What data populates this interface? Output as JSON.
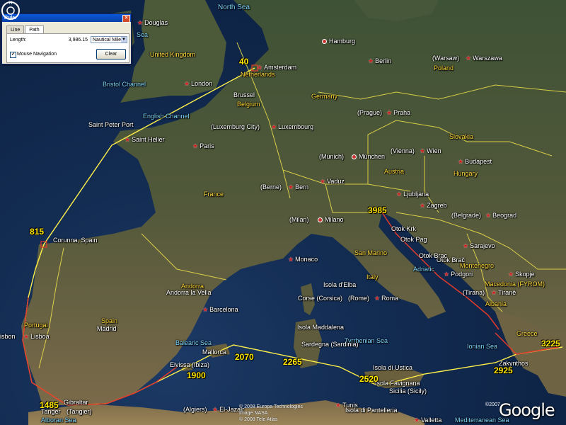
{
  "ruler": {
    "title": "Ruler",
    "close": "×",
    "tabs": [
      "Line",
      "Path"
    ],
    "active_tab": "Path",
    "length_label": "Length:",
    "length_value": "3,986.15",
    "units": "Nautical Miles",
    "mouse_nav_label": "Mouse Navigation",
    "mouse_nav_checked": true,
    "clear_label": "Clear"
  },
  "route_marks": {
    "m40": "40",
    "m815": "815",
    "m1485": "1485",
    "m1900": "1900",
    "m2070": "2070",
    "m2265": "2265",
    "m2520": "2520",
    "m2925": "2925",
    "m3225": "3225",
    "m3985": "3985"
  },
  "seas": {
    "north_sea": "North Sea",
    "english_channel": "English Channel",
    "bristol_channel": "Bristol Channel",
    "balearic_sea": "Balearic Sea",
    "tyrrhenian_sea": "Tyrrhenian Sea",
    "ionian_sea": "Ionian Sea",
    "alboran_sea": "Alboran Sea",
    "adriatic": "Adriatic",
    "mediterranean_sea": "Mediterranean Sea",
    "sea_top": "Sea"
  },
  "countries": {
    "uk": "United Kingdom",
    "netherlands": "Netherlands",
    "belgium": "Belgium",
    "germany": "Germany",
    "france": "France",
    "poland": "Poland",
    "slovakia": "Slovakia",
    "austria": "Austria",
    "hungary": "Hungary",
    "italy": "Italy",
    "spain": "Spain",
    "portugal": "Portugal",
    "andorra": "Andorra",
    "san_marino": "San Marino",
    "albania": "Albania",
    "montenegro": "Montenegro",
    "macedonia": "Macedonia (FYROM)",
    "greece": "Greece",
    "luxembourg": "(Luxemburg City)",
    "croatia_coast": "Otok Brač"
  },
  "cities": {
    "douglas": "Douglas",
    "london": "London",
    "amsterdam": "Amsterdam",
    "hamburg": "Hamburg",
    "berlin": "Berlin",
    "warsaw_local": "(Warsaw)",
    "warszawa": "Warszawa",
    "brussel": "Brussel",
    "prague_local": "(Prague)",
    "praha": "Praha",
    "saint_peter_port": "Saint Peter Port",
    "saint_helier": "Saint Helier",
    "luxembourg": "Luxembourg",
    "paris": "Paris",
    "munich_local": "(Munich)",
    "munchen": "München",
    "vienna_local": "(Vienna)",
    "wien": "Wien",
    "budapest": "Budapest",
    "berne_local": "(Berne)",
    "bern": "Bern",
    "vaduz": "Vaduz",
    "ljubljana": "Ljubljana",
    "zagreb": "Zagreb",
    "belgrade_local": "(Belgrade)",
    "beograd": "Beograd",
    "milan_local": "(Milan)",
    "milano": "Milano",
    "sarajevo": "Sarajevo",
    "corunna": "Corunna, Spain",
    "monaco": "Monaco",
    "podgorica": "Podgori",
    "skopje": "Skopje",
    "tirana_local": "(Tirana)",
    "tirane": "Tiranë",
    "andorra_la_vella": "Andorra la Vella",
    "barcelona": "Barcelona",
    "rome_local": "(Rome)",
    "roma": "Roma",
    "madrid": "Madrid",
    "lisboa": "Lisboa",
    "lisbon": "isbon",
    "corse": "Corse (Corsica)",
    "isola_elba": "Isola d'Elba",
    "isola_maddalena": "Isola Maddalena",
    "sardegna": "Sardegna (Sardinia)",
    "isola_ustica": "Isola di Ustica",
    "isola_favignana": "Isola Favignana",
    "sicilia": "Sicilia (Sicily)",
    "zakynthos": "Zakynthos",
    "mallorca": "Mallorca",
    "eivissa": "Eivissa (Ibiza)",
    "algiers_local": "(Algiers)",
    "el_jazair": "El-Jazair",
    "tunis": "Tunis",
    "pantelleria": "Isola di Pantelleria",
    "valletta": "Valletta",
    "tanger": "Tanger",
    "tangier": "(Tangier)",
    "gibraltar": "Gibraltar",
    "croatia_otok": "Otok Krk",
    "otok_pag": "Otok Pag",
    "otok_brac": "Otok Brac"
  },
  "attribution": {
    "line1": "© 2008 Europa Technologies",
    "line2": "Image NASA",
    "line3": "© 2008 Tele Atlas"
  },
  "copyright": "©2007",
  "logo": "Google",
  "compass": "N",
  "colors": {
    "route": "#fff04a",
    "route_coast": "#e23a2a",
    "border": "#f0e24a",
    "sea_label": "#7fd7ff"
  }
}
